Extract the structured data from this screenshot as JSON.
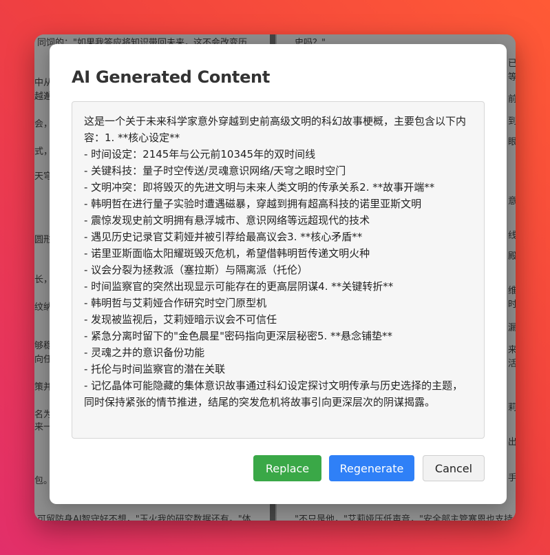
{
  "background_doc": {
    "left_snippets": [
      "同饲的：\"如果我答应将知识带回未来，这不会改变历",
      "中从未",
      "越邂受",
      "会，'写",
      "式，牧",
      "天穹",
      "圆形历",
      "长，",
      "纹纳米",
      "够稳",
      "向任",
      "策并亨",
      "名为",
      "来一",
      "包。",
      "可留防身AI智守好不想，\"玉火我的研究数据还有。\"体"
    ],
    "right_snippets": [
      "史吗？\"",
      "已着",
      "等文",
      "前信",
      "到是",
      "眼",
      "意。",
      "线的",
      "殿的",
      "维持",
      "时宜",
      "漏然",
      "来",
      "活",
      "莉",
      "出身",
      "手人",
      "\"不只是他，\"艾莉娅压低声音，\"安全部主管塞恩也支持"
    ]
  },
  "dialog": {
    "title": "AI Generated Content",
    "content": "这是一个关于未来科学家意外穿越到史前高级文明的科幻故事梗概，主要包含以下内容：1. **核心设定**\n- 时间设定：2145年与公元前10345年的双时间线\n- 关键科技：量子时空传送/灵魂意识网络/天穹之眼时空门\n- 文明冲突：即将毁灭的先进文明与未来人类文明的传承关系2. **故事开端**\n- 韩明哲在进行量子实验时遭遇磁暴，穿越到拥有超高科技的诺里亚斯文明\n- 震惊发现史前文明拥有悬浮城市、意识网络等远超现代的技术\n- 遇见历史记录官艾莉娅并被引荐给最高议会3. **核心矛盾**\n- 诺里亚斯面临太阳耀斑毁灭危机，希望借韩明哲传递文明火种\n- 议会分裂为拯救派（塞拉斯）与隔离派（托伦）\n- 时间监察官的突然出现显示可能存在的更高层阴谋4. **关键转折**\n- 韩明哲与艾莉娅合作研究时空门原型机\n- 发现被监视后，艾莉娅暗示议会不可信任\n- 紧急分离时留下的\"金色晨星\"密码指向更深层秘密5. **悬念铺垫**\n- 灵魂之井的意识备份功能\n- 托伦与时间监察官的潜在关联\n- 记忆晶体可能隐藏的集体意识故事通过科幻设定探讨文明传承与历史选择的主题，同时保持紧张的情节推进，结尾的突发危机将故事引向更深层次的阴谋揭露。",
    "buttons": {
      "replace": "Replace",
      "regenerate": "Regenerate",
      "cancel": "Cancel"
    }
  },
  "colors": {
    "replace": "#3aa847",
    "regenerate": "#2f80f7",
    "cancel_bg": "#f2f2f2"
  }
}
